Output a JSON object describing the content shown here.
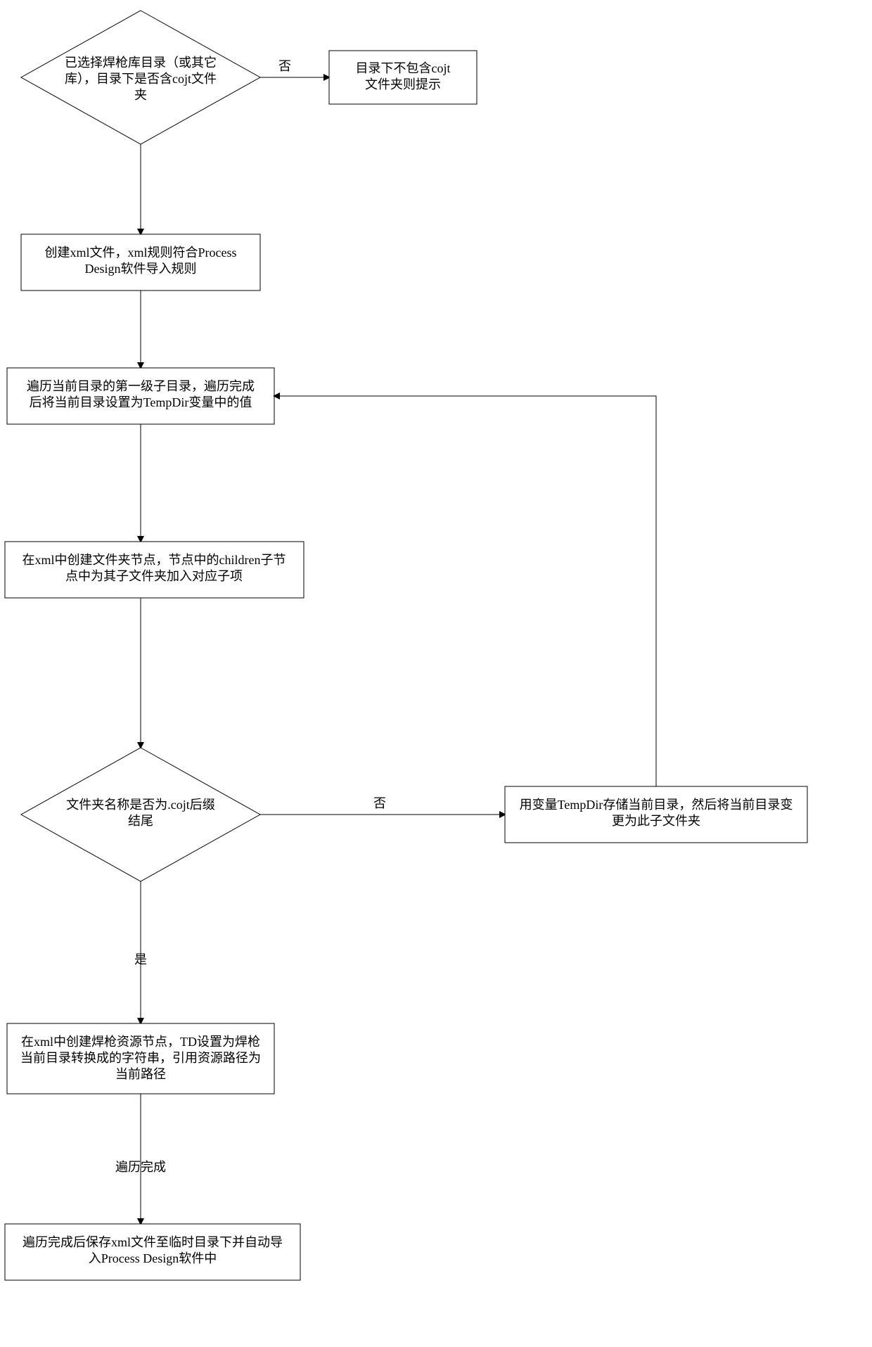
{
  "flow": {
    "d1": {
      "line1": "已选择焊枪库目录（或其它",
      "line2": "库），目录下是否含cojt文件",
      "line3": "夹"
    },
    "p_prompt": {
      "line1": "目录下不包含cojt",
      "line2": "文件夹则提示"
    },
    "p_create_xml": {
      "line1": "创建xml文件，xml规则符合Process",
      "line2": "Design软件导入规则"
    },
    "p_traverse": {
      "line1": "遍历当前目录的第一级子目录，遍历完成",
      "line2": "后将当前目录设置为TempDir变量中的值"
    },
    "p_children": {
      "line1": "在xml中创建文件夹节点，节点中的children子节",
      "line2": "点中为其子文件夹加入对应子项"
    },
    "d2": {
      "line1": "文件夹名称是否为.cojt后缀",
      "line2": "结尾"
    },
    "p_tempdir": {
      "line1": "用变量TempDir存储当前目录，然后将当前目录变",
      "line2": "更为此子文件夹"
    },
    "p_resource": {
      "line1": "在xml中创建焊枪资源节点，TD设置为焊枪",
      "line2": "当前目录转换成的字符串，引用资源路径为",
      "line3": "当前路径"
    },
    "p_final": {
      "line1": "遍历完成后保存xml文件至临时目录下并自动导",
      "line2": "入Process Design软件中"
    },
    "labels": {
      "no1": "否",
      "no2": "否",
      "yes": "是",
      "done": "遍历完成"
    }
  }
}
